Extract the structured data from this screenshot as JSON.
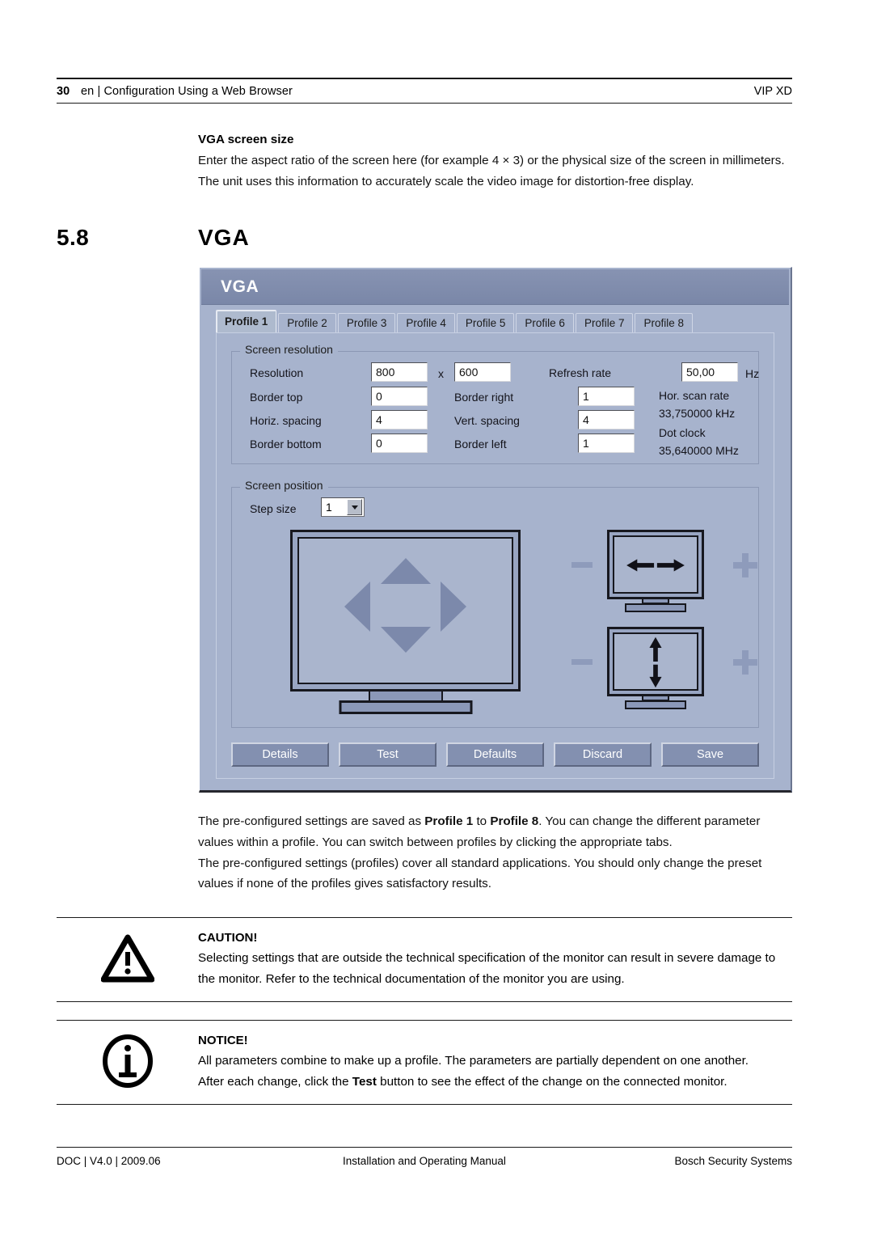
{
  "header": {
    "page_number": "30",
    "left": "en | Configuration Using a Web Browser",
    "right": "VIP XD"
  },
  "intro": {
    "subheading": "VGA screen size",
    "paragraph": "Enter the aspect ratio of the screen here (for example 4 × 3) or the physical size of the screen in millimeters. The unit uses this information to accurately scale the video image for distortion-free display."
  },
  "section": {
    "number": "5.8",
    "title": "VGA"
  },
  "dialog": {
    "title": "VGA",
    "tabs": [
      {
        "label": "Profile 1",
        "active": true
      },
      {
        "label": "Profile 2",
        "active": false
      },
      {
        "label": "Profile 3",
        "active": false
      },
      {
        "label": "Profile 4",
        "active": false
      },
      {
        "label": "Profile 5",
        "active": false
      },
      {
        "label": "Profile 6",
        "active": false
      },
      {
        "label": "Profile 7",
        "active": false
      },
      {
        "label": "Profile 8",
        "active": false
      }
    ],
    "screen_resolution": {
      "legend": "Screen resolution",
      "resolution_label": "Resolution",
      "resolution_width": "800",
      "resolution_separator": "x",
      "resolution_height": "600",
      "refresh_rate_label": "Refresh rate",
      "refresh_rate_value": "50,00",
      "refresh_rate_unit": "Hz",
      "border_top_label": "Border top",
      "border_top_value": "0",
      "border_right_label": "Border right",
      "border_right_value": "1",
      "horiz_spacing_label": "Horiz. spacing",
      "horiz_spacing_value": "4",
      "vert_spacing_label": "Vert. spacing",
      "vert_spacing_value": "4",
      "border_bottom_label": "Border bottom",
      "border_bottom_value": "0",
      "border_left_label": "Border left",
      "border_left_value": "1",
      "hor_scan_rate_label": "Hor. scan rate",
      "hor_scan_rate_value": "33,750000 kHz",
      "dot_clock_label": "Dot clock",
      "dot_clock_value": "35,640000 MHz"
    },
    "screen_position": {
      "legend": "Screen position",
      "step_size_label": "Step size",
      "step_size_value": "1"
    },
    "buttons": [
      {
        "label": "Details"
      },
      {
        "label": "Test"
      },
      {
        "label": "Defaults"
      },
      {
        "label": "Discard"
      },
      {
        "label": "Save"
      }
    ],
    "colors": {
      "titlebar": "#7a87a8",
      "panel": "#a7b3cd",
      "button": "#8390b0",
      "arrow_fill": "#7c89ab"
    }
  },
  "body": {
    "paragraph_1": "The pre-configured settings are saved as ",
    "paragraph_1_bold_a": "Profile 1",
    "paragraph_1_mid": " to ",
    "paragraph_1_bold_b": "Profile 8",
    "paragraph_1_end": ". You can change the different parameter values within a profile. You can switch between profiles by clicking the appropriate tabs.",
    "paragraph_2": "The pre-configured settings (profiles) cover all standard applications. You should only change the preset values if none of the profiles gives satisfactory results."
  },
  "caution": {
    "title": "CAUTION!",
    "text": "Selecting settings that are outside the technical specification of the monitor can result in severe damage to the monitor. Refer to the technical documentation of the monitor you are using."
  },
  "notice": {
    "title": "NOTICE!",
    "text_1": "All parameters combine to make up a profile. The parameters are partially dependent on one another.",
    "text_2_pre": "After each change, click the ",
    "text_2_bold": "Test",
    "text_2_post": " button to see the effect of the change on the connected monitor."
  },
  "footer": {
    "left": "DOC | V4.0 | 2009.06",
    "center": "Installation and Operating Manual",
    "right": "Bosch Security Systems"
  }
}
